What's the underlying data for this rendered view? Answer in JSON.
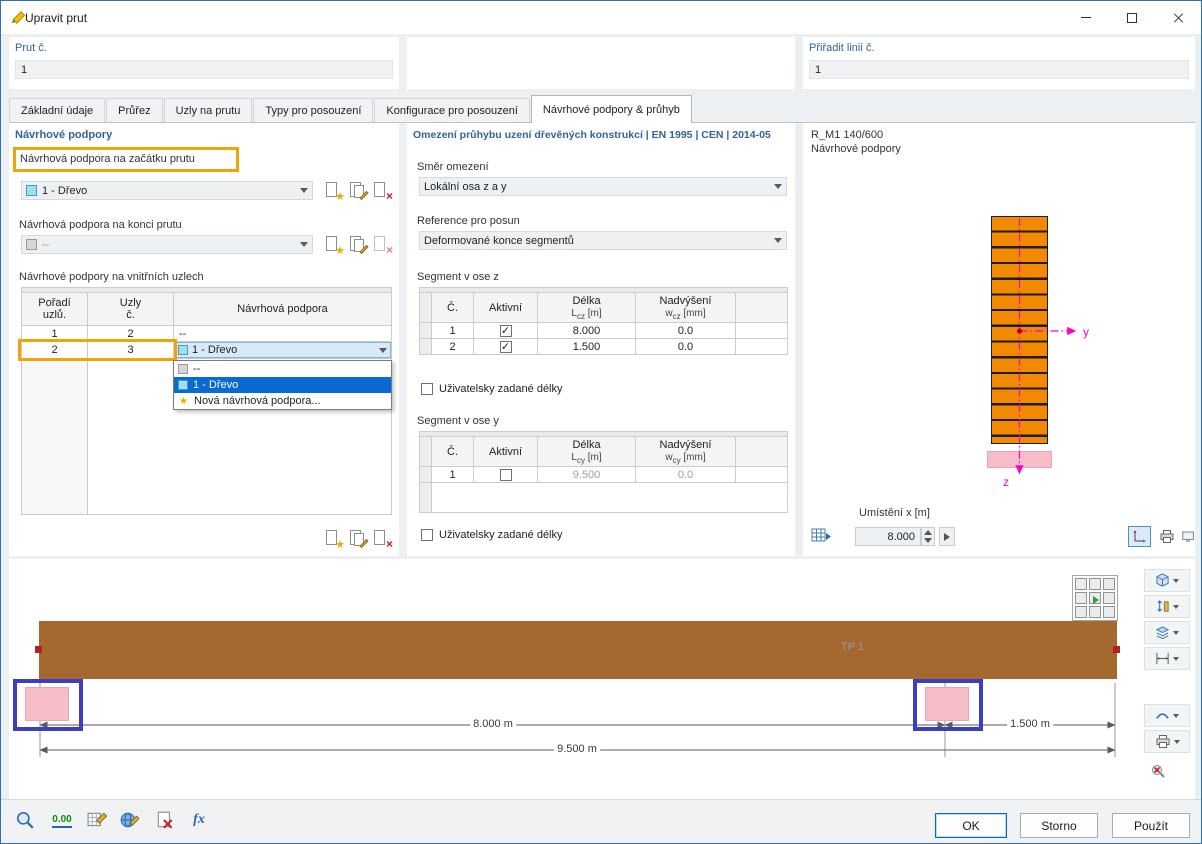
{
  "titlebar": {
    "title": "Upravit prut"
  },
  "header": {
    "member_label": "Prut č.",
    "member_value": "1",
    "line_label": "Přiřadit linii č.",
    "line_value": "1"
  },
  "tabs": [
    {
      "label": "Základní údaje"
    },
    {
      "label": "Průřez"
    },
    {
      "label": "Uzly na prutu"
    },
    {
      "label": "Typy pro posouzení"
    },
    {
      "label": "Konfigurace pro posouzení"
    },
    {
      "label": "Návrhové podpory & průhyb"
    }
  ],
  "supports_panel": {
    "title": "Návrhové podpory",
    "start_label": "Návrhová podpora na začátku prutu",
    "start_value": "1 - Dřevo",
    "end_label": "Návrhová podpora na konci prutu",
    "end_value": "--",
    "internal_label": "Návrhové podpory na vnitřních uzlech",
    "table": {
      "col_order_1": "Pořadí",
      "col_order_2": "uzlů.",
      "col_node_1": "Uzly",
      "col_node_2": "č.",
      "col_support": "Návrhová podpora",
      "rows": [
        {
          "order": "1",
          "node": "2",
          "support": "--"
        },
        {
          "order": "2",
          "node": "3",
          "support": "1 - Dřevo"
        }
      ]
    },
    "dropdown": {
      "selected": "1 - Dřevo",
      "options": [
        {
          "label": "--"
        },
        {
          "label": "1 - Dřevo"
        },
        {
          "label": "Nová návrhová podpora..."
        }
      ]
    }
  },
  "deflection_panel": {
    "title": "Omezení průhybu uzení dřevěných konstrukcí | EN 1995 | CEN | 2014-05",
    "direction_label": "Směr omezení",
    "direction_value": "Lokální osa z a y",
    "reference_label": "Reference pro posun",
    "reference_value": "Deformované konce segmentů",
    "segment_z_label": "Segment v ose z",
    "segment_y_label": "Segment v ose y",
    "user_lengths_label": "Uživatelsky zadané délky",
    "col_no": "Č.",
    "col_active": "Aktivní",
    "col_length": "Délka",
    "col_camber": "Nadvýšení",
    "len_sym": "L",
    "len_sub_z": "cz",
    "len_sub_y": "cy",
    "len_unit": "[m]",
    "cam_sym": "w",
    "cam_sub_z": "cz",
    "cam_sub_y": "cy",
    "cam_unit": "[mm]",
    "segment_z_rows": [
      {
        "no": "1",
        "active": "✓",
        "length": "8.000",
        "camber": "0.0"
      },
      {
        "no": "2",
        "active": "✓",
        "length": "1.500",
        "camber": "0.0"
      }
    ],
    "segment_y_rows": [
      {
        "no": "1",
        "active": "",
        "length": "9.500",
        "camber": "0.0"
      }
    ]
  },
  "preview_panel": {
    "section_name": "R_M1 140/600",
    "subtitle": "Návrhové podpory",
    "axis_y": "y",
    "axis_z": "z",
    "position_label": "Umístění x [m]",
    "position_value": "8.000"
  },
  "graphics": {
    "member_label": "TP 1",
    "dim_segment1": "8.000 m",
    "dim_segment2": "1.500 m",
    "dim_total": "9.500 m"
  },
  "footer": {
    "decimal_label": "0.00",
    "fx_label": "fx",
    "ok": "OK",
    "cancel": "Storno",
    "apply": "Použít"
  },
  "colors": {
    "accent_blue": "#0a6ad4",
    "highlight_orange": "#efa50a",
    "highlight_blue": "#3d3dc2",
    "beam_brown": "#a5682e",
    "beam_orange": "#f28900",
    "support_pink": "#f6bcc8",
    "axis_magenta": "#ff00cc"
  }
}
